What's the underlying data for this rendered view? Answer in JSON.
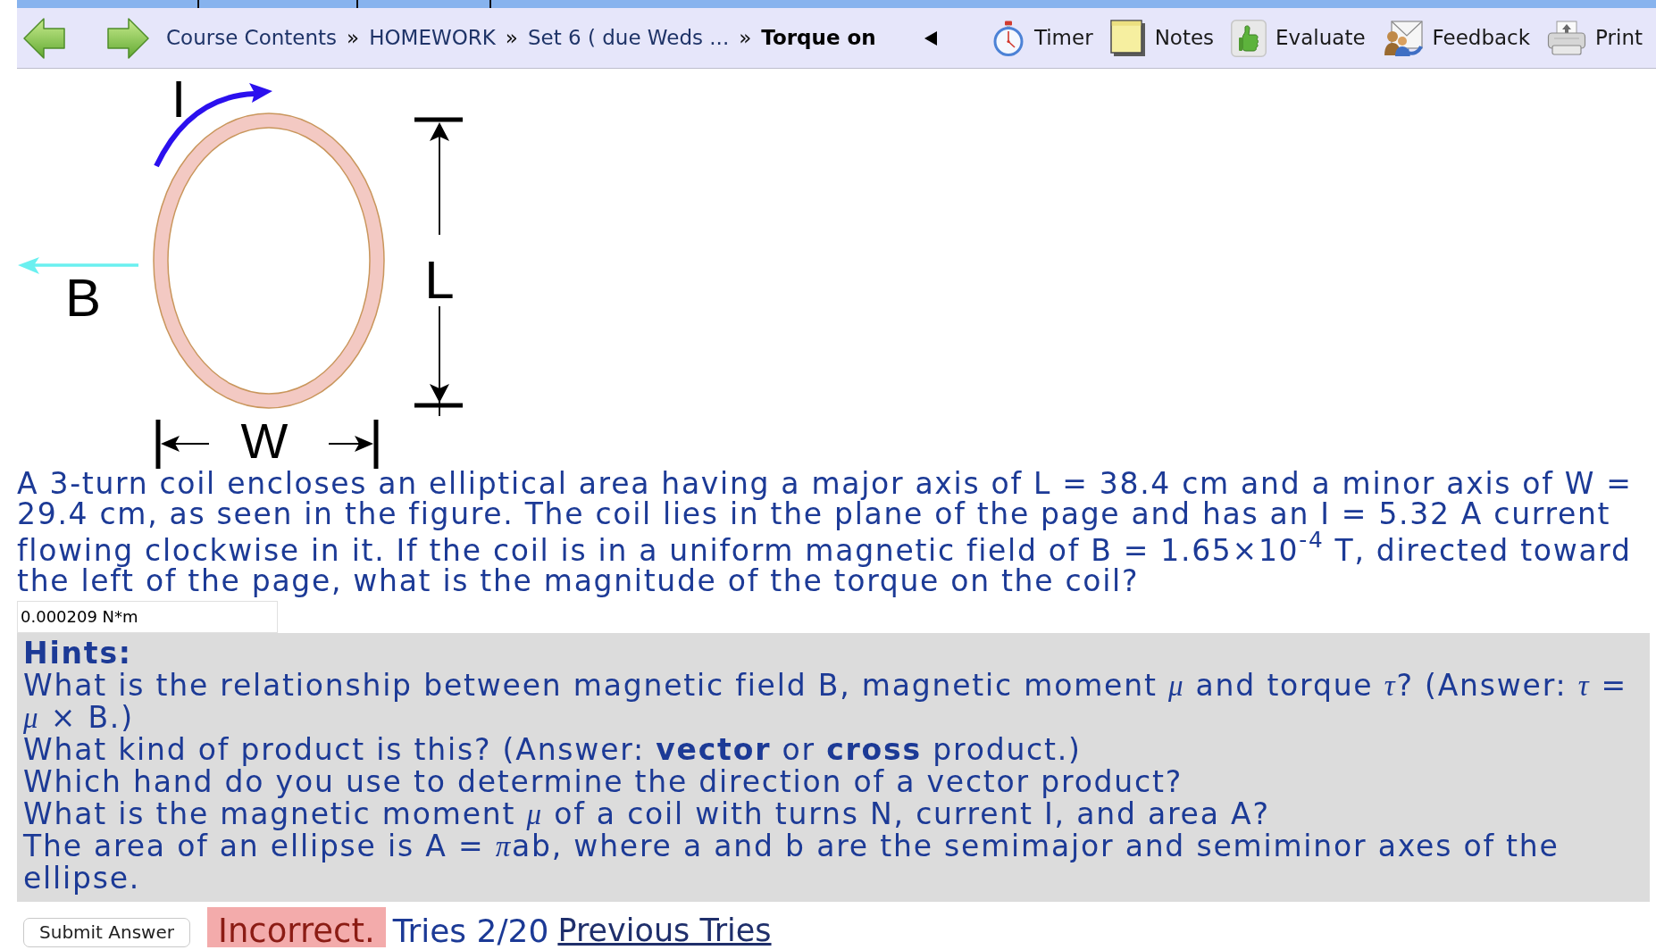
{
  "nav": {
    "breadcrumb": [
      {
        "label": "Course Contents",
        "separator": "»",
        "current": false
      },
      {
        "label": "HOMEWORK",
        "separator": "»",
        "current": false
      },
      {
        "label": "Set 6 ( due Weds ...",
        "separator": "»",
        "current": false
      },
      {
        "label": "Torque on",
        "current": true
      }
    ],
    "tools": [
      {
        "kind": "timer",
        "label": "Timer"
      },
      {
        "kind": "notes",
        "label": "Notes"
      },
      {
        "kind": "evaluate",
        "label": "Evaluate"
      },
      {
        "kind": "feedback",
        "label": "Feedback"
      },
      {
        "kind": "print",
        "label": "Print"
      }
    ]
  },
  "figure": {
    "labels": {
      "current": "I",
      "field": "B",
      "length": "L",
      "width": "W"
    }
  },
  "question": {
    "text": "A 3-turn coil encloses an elliptical area having a major axis of L = 38.4 cm and a minor axis of W = 29.4 cm, as seen in the figure. The coil lies in the plane of the page and has an I = 5.32 A current flowing clockwise in it. If the coil is in a uniform magnetic field of B = 1.65×10$^{-4}$ T, directed toward the left of the page, what is the magnitude of the torque on the coil?",
    "answer": {
      "value": "0.000209 N*m"
    }
  },
  "hints": {
    "title": "Hints:",
    "items": [
      "What is the relationship between magnetic field B, magnetic moment *μ* and torque *τ*? (Answer: *τ* = *μ* × B.)",
      "What kind of product is this? (Answer: **vector** or **cross** product.)",
      "Which hand do you use to determine the direction of a vector product?",
      "What is the magnetic moment *μ* of a coil with turns N, current I, and area A?",
      "The area of an ellipse is A = *π*​ab, where a and b are the semimajor and semiminor axes of the ellipse."
    ]
  },
  "submission": {
    "button": "Submit Answer",
    "status": {
      "message": "Incorrect.",
      "correct": false
    },
    "tries": "Tries 2/20",
    "previous_tries_link": "Previous Tries"
  }
}
